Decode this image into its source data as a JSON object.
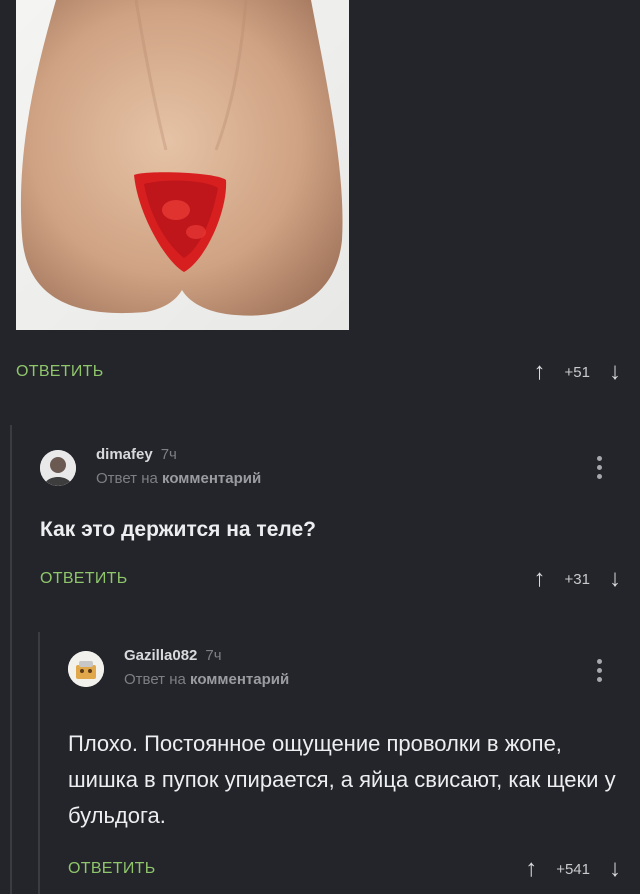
{
  "post": {
    "reply_label": "ОТВЕТИТЬ",
    "score": "+51"
  },
  "comments": [
    {
      "username": "dimafey",
      "time": "7ч",
      "subline_prefix": "Ответ на",
      "subline_link": "комментарий",
      "text": "Как это держится на теле?",
      "reply_label": "ОТВЕТИТЬ",
      "score": "+31"
    },
    {
      "username": "Gazilla082",
      "time": "7ч",
      "subline_prefix": "Ответ на",
      "subline_link": "комментарий",
      "text": "Плохо. Постоянное ощущение проволки в жопе, шишка в пупок упирается, а яйца свисают, как щеки у бульдога.",
      "reply_label": "ОТВЕТИТЬ",
      "score": "+541"
    }
  ],
  "icons": {
    "upvote": "arrow-up-icon",
    "downvote": "arrow-down-icon",
    "menu": "kebab-menu-icon"
  },
  "colors": {
    "background": "#23252a",
    "reply_link": "#8fc56b",
    "thread_line": "#3a3c42"
  }
}
